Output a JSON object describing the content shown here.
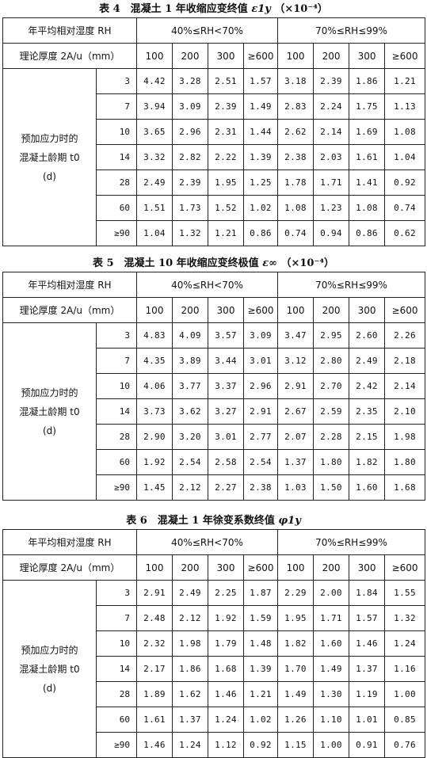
{
  "tables": [
    {
      "caption_prefix": "表 4",
      "caption_text": "混凝土 1 年收缩应变终值",
      "caption_symbol": "ε1y",
      "caption_unit": "（×10⁻⁴）",
      "header": {
        "rh_label": "年平均相对湿度 RH",
        "rh_range_1": "40%≤RH<70%",
        "rh_range_2": "70%≤RH≤99%",
        "thickness_label": "理论厚度 2A/u（mm）",
        "thickness": [
          "100",
          "200",
          "300",
          "≥600",
          "100",
          "200",
          "300",
          "≥600"
        ]
      },
      "row_label": [
        "预加应力时的",
        "混凝土龄期 t0",
        "(d)"
      ],
      "rows": [
        {
          "age": "3",
          "values": [
            "4.42",
            "3.28",
            "2.51",
            "1.57",
            "3.18",
            "2.39",
            "1.86",
            "1.21"
          ]
        },
        {
          "age": "7",
          "values": [
            "3.94",
            "3.09",
            "2.39",
            "1.49",
            "2.83",
            "2.24",
            "1.75",
            "1.13"
          ]
        },
        {
          "age": "10",
          "values": [
            "3.65",
            "2.96",
            "2.31",
            "1.44",
            "2.62",
            "2.14",
            "1.69",
            "1.08"
          ]
        },
        {
          "age": "14",
          "values": [
            "3.32",
            "2.82",
            "2.22",
            "1.39",
            "2.38",
            "2.03",
            "1.61",
            "1.04"
          ]
        },
        {
          "age": "28",
          "values": [
            "2.49",
            "2.39",
            "1.95",
            "1.25",
            "1.78",
            "1.71",
            "1.41",
            "0.92"
          ]
        },
        {
          "age": "60",
          "values": [
            "1.51",
            "1.73",
            "1.52",
            "1.02",
            "1.08",
            "1.23",
            "1.08",
            "0.74"
          ]
        },
        {
          "age": "≥90",
          "values": [
            "1.04",
            "1.32",
            "1.21",
            "0.86",
            "0.74",
            "0.94",
            "0.86",
            "0.62"
          ]
        }
      ]
    },
    {
      "caption_prefix": "表 5",
      "caption_text": "混凝土 10 年收缩应变终极值",
      "caption_symbol": "ε∞",
      "caption_unit": "（×10⁻⁴）",
      "header": {
        "rh_label": "年平均相对湿度 RH",
        "rh_range_1": "40%≤RH<70%",
        "rh_range_2": "70%≤RH≤99%",
        "thickness_label": "理论厚度 2A/u（mm）",
        "thickness": [
          "100",
          "200",
          "300",
          "≥600",
          "100",
          "200",
          "300",
          "≥600"
        ]
      },
      "row_label": [
        "预加应力时的",
        "混凝土龄期 t0",
        "(d)"
      ],
      "rows": [
        {
          "age": "3",
          "values": [
            "4.83",
            "4.09",
            "3.57",
            "3.09",
            "3.47",
            "2.95",
            "2.60",
            "2.26"
          ]
        },
        {
          "age": "7",
          "values": [
            "4.35",
            "3.89",
            "3.44",
            "3.01",
            "3.12",
            "2.80",
            "2.49",
            "2.18"
          ]
        },
        {
          "age": "10",
          "values": [
            "4.06",
            "3.77",
            "3.37",
            "2.96",
            "2.91",
            "2.70",
            "2.42",
            "2.14"
          ]
        },
        {
          "age": "14",
          "values": [
            "3.73",
            "3.62",
            "3.27",
            "2.91",
            "2.67",
            "2.59",
            "2.35",
            "2.10"
          ]
        },
        {
          "age": "28",
          "values": [
            "2.90",
            "3.20",
            "3.01",
            "2.77",
            "2.07",
            "2.28",
            "2.15",
            "1.98"
          ]
        },
        {
          "age": "60",
          "values": [
            "1.92",
            "2.54",
            "2.58",
            "2.54",
            "1.37",
            "1.80",
            "1.82",
            "1.80"
          ]
        },
        {
          "age": "≥90",
          "values": [
            "1.45",
            "2.12",
            "2.27",
            "2.38",
            "1.03",
            "1.50",
            "1.60",
            "1.68"
          ]
        }
      ]
    },
    {
      "caption_prefix": "表 6",
      "caption_text": "混凝土 1 年徐变系数终值",
      "caption_symbol": "φ1y",
      "caption_unit": "",
      "header": {
        "rh_label": "年平均相对湿度 RH",
        "rh_range_1": "40%≤RH<70%",
        "rh_range_2": "70%≤RH≤99%",
        "thickness_label": "理论厚度 2A/u（mm）",
        "thickness": [
          "100",
          "200",
          "300",
          "≥600",
          "100",
          "200",
          "300",
          "≥600"
        ]
      },
      "row_label": [
        "预加应力时的",
        "混凝土龄期 t0",
        "(d)"
      ],
      "rows": [
        {
          "age": "3",
          "values": [
            "2.91",
            "2.49",
            "2.25",
            "1.87",
            "2.29",
            "2.00",
            "1.84",
            "1.55"
          ]
        },
        {
          "age": "7",
          "values": [
            "2.48",
            "2.12",
            "1.92",
            "1.59",
            "1.95",
            "1.71",
            "1.57",
            "1.32"
          ]
        },
        {
          "age": "10",
          "values": [
            "2.32",
            "1.98",
            "1.79",
            "1.48",
            "1.82",
            "1.60",
            "1.46",
            "1.24"
          ]
        },
        {
          "age": "14",
          "values": [
            "2.17",
            "1.86",
            "1.68",
            "1.39",
            "1.70",
            "1.49",
            "1.37",
            "1.16"
          ]
        },
        {
          "age": "28",
          "values": [
            "1.89",
            "1.62",
            "1.46",
            "1.21",
            "1.49",
            "1.30",
            "1.19",
            "1.00"
          ]
        },
        {
          "age": "60",
          "values": [
            "1.61",
            "1.37",
            "1.24",
            "1.02",
            "1.26",
            "1.10",
            "1.01",
            "0.85"
          ]
        },
        {
          "age": "≥90",
          "values": [
            "1.46",
            "1.24",
            "1.12",
            "0.92",
            "1.15",
            "1.00",
            "0.91",
            "0.76"
          ]
        }
      ]
    }
  ]
}
